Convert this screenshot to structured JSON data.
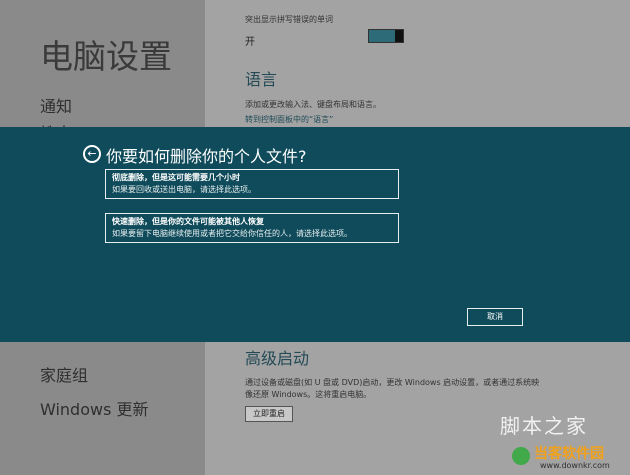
{
  "sidebar": {
    "title": "电脑设置",
    "nav": [
      {
        "label": "通知"
      },
      {
        "label": "搜索"
      },
      {
        "label": "家庭组"
      },
      {
        "label": "Windows 更新"
      }
    ]
  },
  "main": {
    "top_partial": "突出显示拼写错误的单词",
    "toggle": {
      "value_label": "开",
      "on_fraction": 0.75
    },
    "language_heading": "语言",
    "language_desc": "添加或更改输入法、键盘布局和语言。",
    "language_link": "转到控制面板中的“语言”",
    "advanced_heading": "高级启动",
    "advanced_desc_1": "通过设备或磁盘(如 U 盘或 DVD)启动，更改 Windows 启动设置，或者通过系统映",
    "advanced_desc_2": "像还原 Windows。这将重启电脑。",
    "restart_button": "立即重启"
  },
  "dialog": {
    "title": "你要如何删除你的个人文件?",
    "options": [
      {
        "line1": "彻底删除，但是这可能需要几个小时",
        "line2": "如果要回收或送出电脑，请选择此选项。"
      },
      {
        "line1": "快速删除，但是你的文件可能被其他人恢复",
        "line2": "如果要留下电脑继续使用或者把它交给你信任的人，请选择此选项。"
      }
    ],
    "cancel_label": "取消"
  },
  "watermark": {
    "text_1": "脚本之家",
    "brand": "当客软件园",
    "url": "www.downkr.com"
  },
  "colors": {
    "overlay": "#0f4b5a",
    "accent": "#2e6b78"
  }
}
